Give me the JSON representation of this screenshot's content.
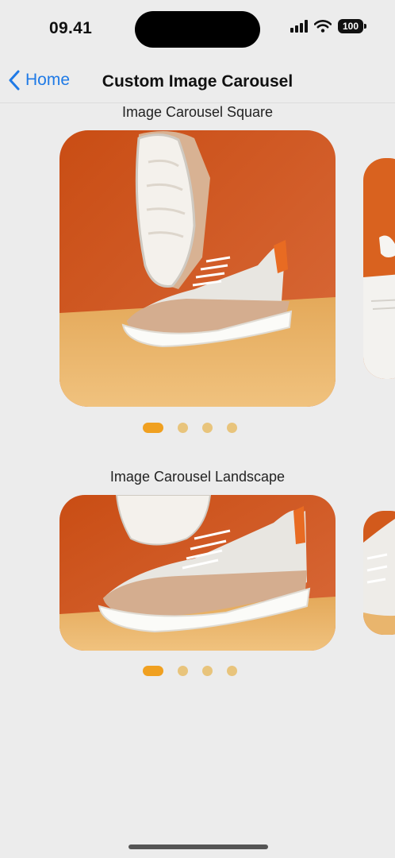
{
  "status_bar": {
    "time": "09.41",
    "battery": "100"
  },
  "nav": {
    "back_label": "Home",
    "title": "Custom Image Carousel"
  },
  "sections": [
    {
      "title": "Image Carousel Square",
      "pages": 4,
      "active_page": 1
    },
    {
      "title": "Image Carousel Landscape",
      "pages": 4,
      "active_page": 1
    }
  ],
  "colors": {
    "accent_blue": "#1f7ae6",
    "background_orange": "#d25a1c",
    "floor_sand": "#e9b56d",
    "dot_active": "#f0a020",
    "dot_inactive": "#e8c47c"
  }
}
